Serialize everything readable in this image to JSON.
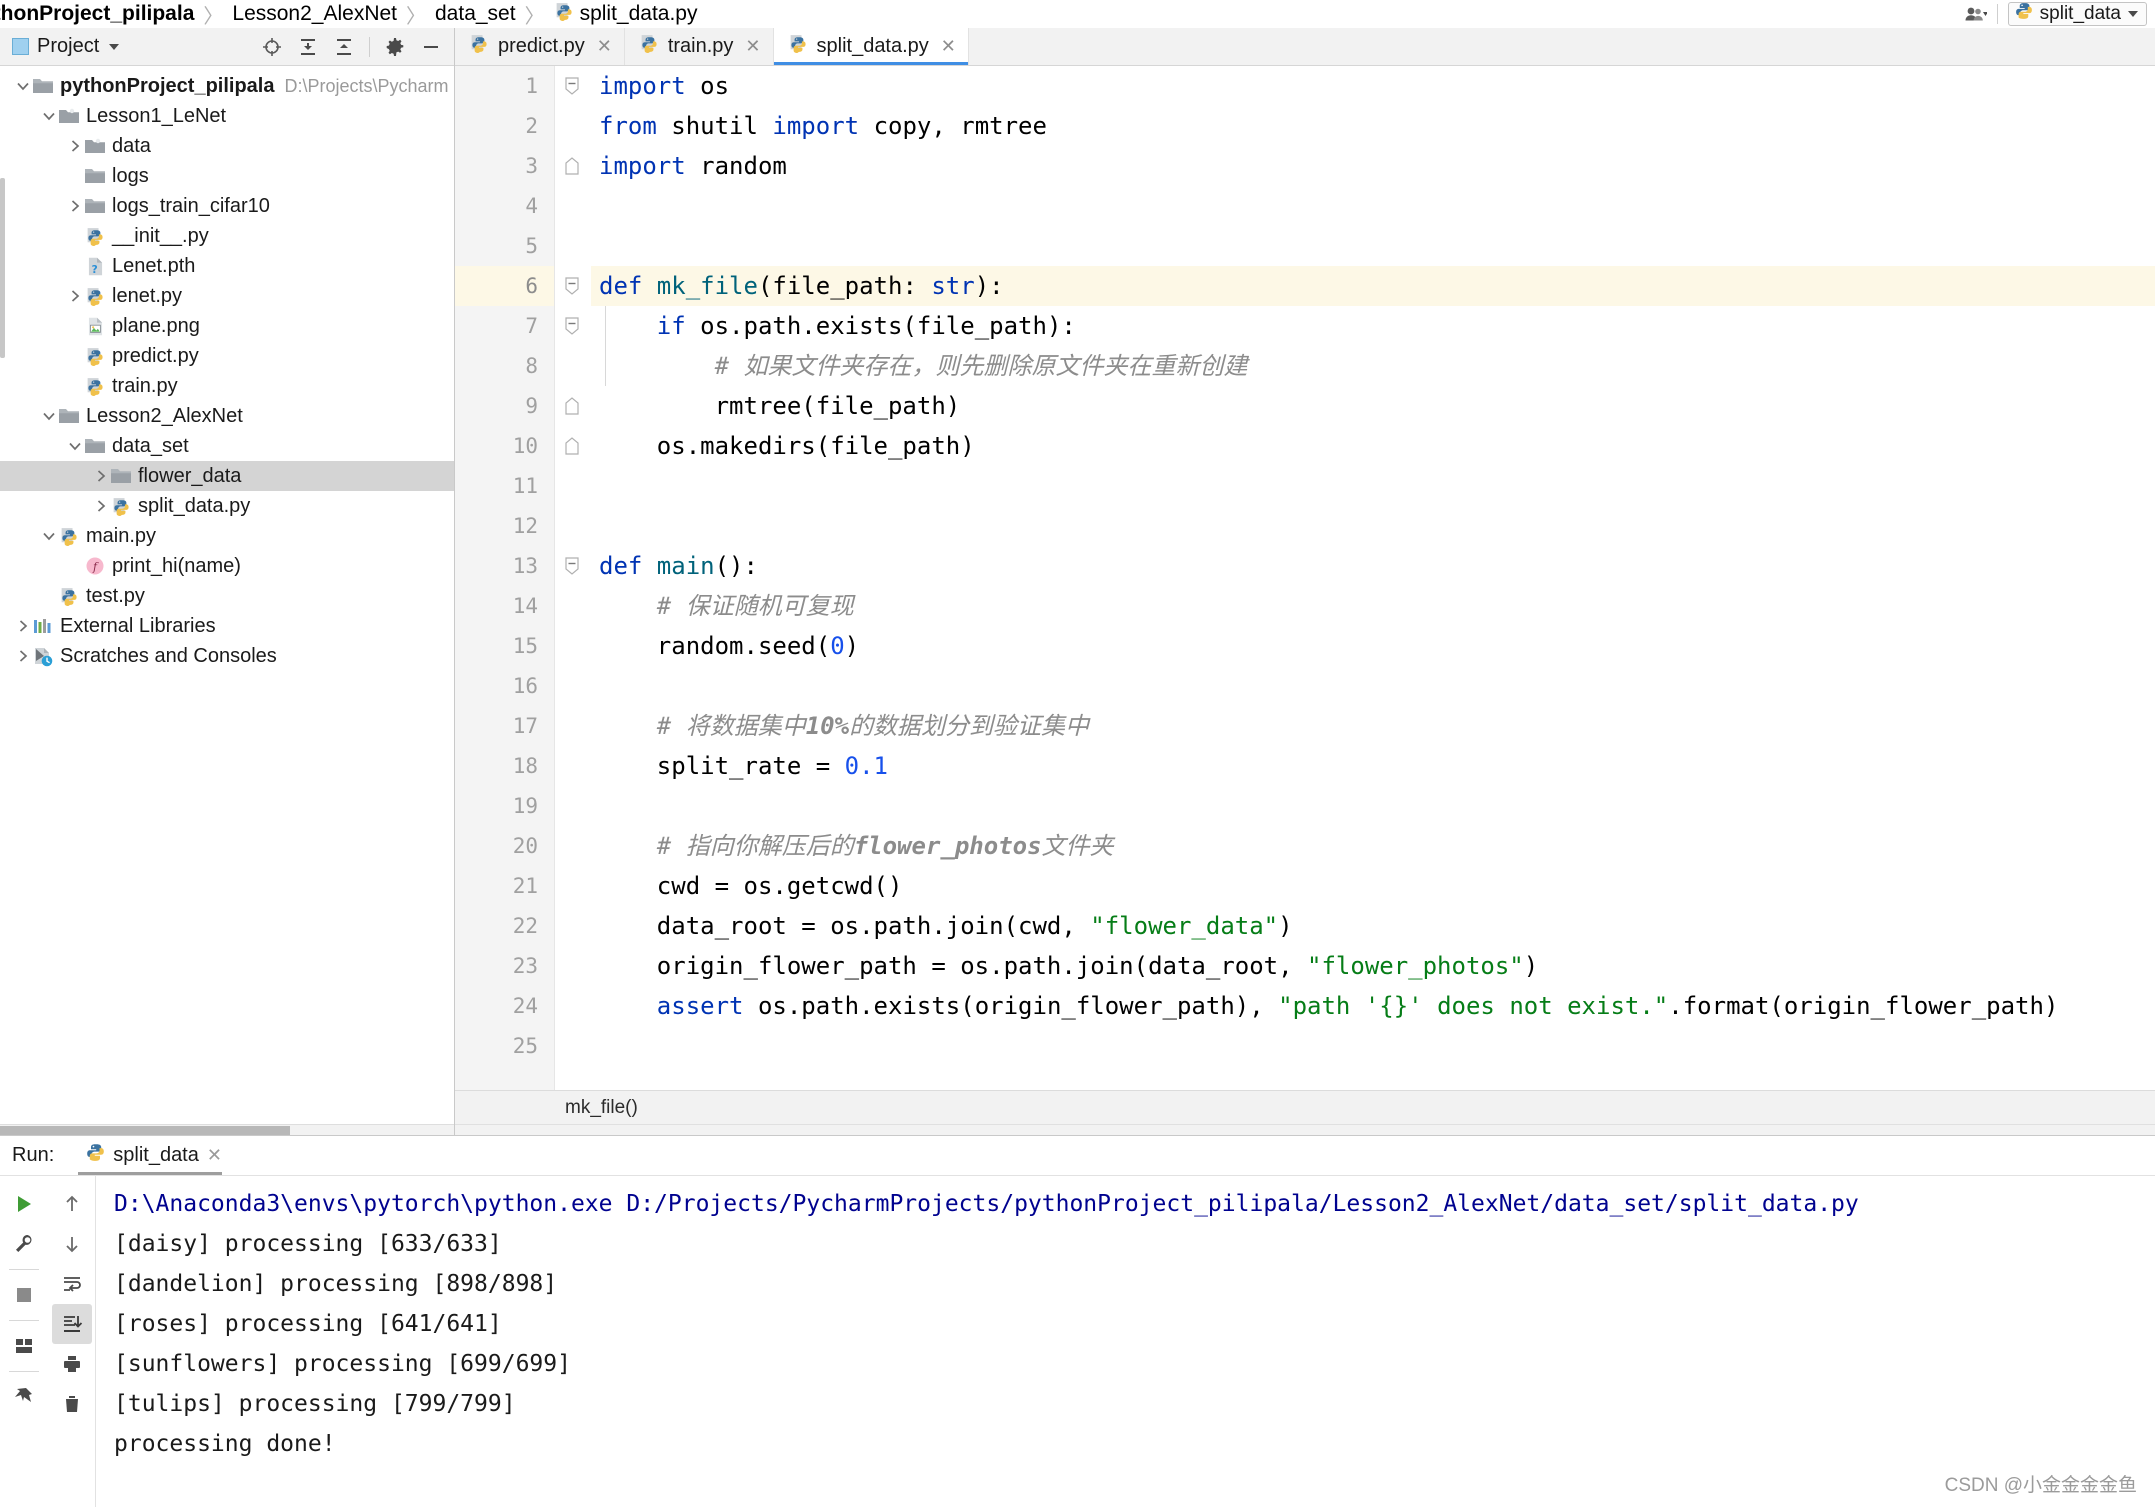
{
  "breadcrumb": {
    "items": [
      "ythonProject_pilipala",
      "Lesson2_AlexNet",
      "data_set",
      "split_data.py"
    ],
    "separator": "〉"
  },
  "titlebar_right": {
    "account_icon": "user-icon",
    "run_config": "split_data"
  },
  "project_panel": {
    "title": "Project",
    "icons": [
      "locate-icon",
      "expand-all-icon",
      "collapse-all-icon",
      "gear-icon",
      "minimize-icon"
    ],
    "tree": [
      {
        "depth": 0,
        "arrow": "down",
        "icon": "folder",
        "label": "pythonProject_pilipala",
        "bold": true,
        "hint": "D:\\Projects\\Pycharm",
        "selected": false
      },
      {
        "depth": 1,
        "arrow": "down",
        "icon": "module",
        "label": "Lesson1_LeNet",
        "bold": false,
        "hint": "",
        "selected": false
      },
      {
        "depth": 2,
        "arrow": "right",
        "icon": "module",
        "label": "data",
        "bold": false,
        "hint": "",
        "selected": false
      },
      {
        "depth": 2,
        "arrow": "none",
        "icon": "folder",
        "label": "logs",
        "bold": false,
        "hint": "",
        "selected": false
      },
      {
        "depth": 2,
        "arrow": "right",
        "icon": "folder",
        "label": "logs_train_cifar10",
        "bold": false,
        "hint": "",
        "selected": false
      },
      {
        "depth": 2,
        "arrow": "none",
        "icon": "python",
        "label": "__init__.py",
        "bold": false,
        "hint": "",
        "selected": false
      },
      {
        "depth": 2,
        "arrow": "none",
        "icon": "unknown",
        "label": "Lenet.pth",
        "bold": false,
        "hint": "",
        "selected": false
      },
      {
        "depth": 2,
        "arrow": "right",
        "icon": "python",
        "label": "lenet.py",
        "bold": false,
        "hint": "",
        "selected": false
      },
      {
        "depth": 2,
        "arrow": "none",
        "icon": "image",
        "label": "plane.png",
        "bold": false,
        "hint": "",
        "selected": false
      },
      {
        "depth": 2,
        "arrow": "none",
        "icon": "python",
        "label": "predict.py",
        "bold": false,
        "hint": "",
        "selected": false
      },
      {
        "depth": 2,
        "arrow": "none",
        "icon": "python",
        "label": "train.py",
        "bold": false,
        "hint": "",
        "selected": false
      },
      {
        "depth": 1,
        "arrow": "down",
        "icon": "folder",
        "label": "Lesson2_AlexNet",
        "bold": false,
        "hint": "",
        "selected": false
      },
      {
        "depth": 2,
        "arrow": "down",
        "icon": "folder",
        "label": "data_set",
        "bold": false,
        "hint": "",
        "selected": false
      },
      {
        "depth": 3,
        "arrow": "right",
        "icon": "folder",
        "label": "flower_data",
        "bold": false,
        "hint": "",
        "selected": true
      },
      {
        "depth": 3,
        "arrow": "right",
        "icon": "python",
        "label": "split_data.py",
        "bold": false,
        "hint": "",
        "selected": false
      },
      {
        "depth": 1,
        "arrow": "down",
        "icon": "python",
        "label": "main.py",
        "bold": false,
        "hint": "",
        "selected": false
      },
      {
        "depth": 2,
        "arrow": "none",
        "icon": "function",
        "label": "print_hi(name)",
        "bold": false,
        "hint": "",
        "selected": false
      },
      {
        "depth": 1,
        "arrow": "none",
        "icon": "python",
        "label": "test.py",
        "bold": false,
        "hint": "",
        "selected": false
      },
      {
        "depth": 0,
        "arrow": "right",
        "icon": "libs",
        "label": "External Libraries",
        "bold": false,
        "hint": "",
        "selected": false
      },
      {
        "depth": 0,
        "arrow": "right",
        "icon": "scratch",
        "label": "Scratches and Consoles",
        "bold": false,
        "hint": "",
        "selected": false
      }
    ]
  },
  "editor": {
    "tabs": [
      {
        "label": "predict.py",
        "icon": "python",
        "active": false,
        "closable": true
      },
      {
        "label": "train.py",
        "icon": "python",
        "active": false,
        "closable": true
      },
      {
        "label": "split_data.py",
        "icon": "python",
        "active": true,
        "closable": true
      }
    ],
    "current_line": 6,
    "status_breadcrumb": "mk_file()",
    "line_numbers": [
      1,
      2,
      3,
      4,
      5,
      6,
      7,
      8,
      9,
      10,
      11,
      12,
      13,
      14,
      15,
      16,
      17,
      18,
      19,
      20,
      21,
      22,
      23,
      24,
      25
    ],
    "code": [
      {
        "n": 1,
        "tokens": [
          {
            "t": "import ",
            "c": "kw"
          },
          {
            "t": "os",
            "c": "pred"
          }
        ]
      },
      {
        "n": 2,
        "tokens": [
          {
            "t": "from ",
            "c": "kw"
          },
          {
            "t": "shutil ",
            "c": "pred"
          },
          {
            "t": "import ",
            "c": "kw"
          },
          {
            "t": "copy, rmtree",
            "c": "pred"
          }
        ]
      },
      {
        "n": 3,
        "tokens": [
          {
            "t": "import ",
            "c": "kw"
          },
          {
            "t": "random",
            "c": "pred"
          }
        ]
      },
      {
        "n": 4,
        "tokens": []
      },
      {
        "n": 5,
        "tokens": []
      },
      {
        "n": 6,
        "tokens": [
          {
            "t": "def ",
            "c": "kw"
          },
          {
            "t": "mk_file",
            "c": "fn"
          },
          {
            "t": "(file_path: ",
            "c": "pred"
          },
          {
            "t": "str",
            "c": "kw"
          },
          {
            "t": "):",
            "c": "pred"
          }
        ]
      },
      {
        "n": 7,
        "tokens": [
          {
            "t": "    ",
            "c": "pred"
          },
          {
            "t": "if ",
            "c": "kw"
          },
          {
            "t": "os.path.exists(file_path):",
            "c": "pred"
          }
        ]
      },
      {
        "n": 8,
        "tokens": [
          {
            "t": "        ",
            "c": "pred"
          },
          {
            "t": "# ",
            "c": "cmt"
          },
          {
            "t": "如果文件夹存在，则先删除原文件夹在重新创建",
            "c": "cmt"
          }
        ]
      },
      {
        "n": 9,
        "tokens": [
          {
            "t": "        rmtree(file_path)",
            "c": "pred"
          }
        ]
      },
      {
        "n": 10,
        "tokens": [
          {
            "t": "    os.makedirs(file_path)",
            "c": "pred"
          }
        ]
      },
      {
        "n": 11,
        "tokens": []
      },
      {
        "n": 12,
        "tokens": []
      },
      {
        "n": 13,
        "tokens": [
          {
            "t": "def ",
            "c": "kw"
          },
          {
            "t": "main",
            "c": "fn"
          },
          {
            "t": "():",
            "c": "pred"
          }
        ]
      },
      {
        "n": 14,
        "tokens": [
          {
            "t": "    ",
            "c": "pred"
          },
          {
            "t": "# ",
            "c": "cmt"
          },
          {
            "t": "保证随机可复现",
            "c": "cmt"
          }
        ]
      },
      {
        "n": 15,
        "tokens": [
          {
            "t": "    random.seed(",
            "c": "pred"
          },
          {
            "t": "0",
            "c": "num"
          },
          {
            "t": ")",
            "c": "pred"
          }
        ]
      },
      {
        "n": 16,
        "tokens": []
      },
      {
        "n": 17,
        "tokens": [
          {
            "t": "    ",
            "c": "pred"
          },
          {
            "t": "# ",
            "c": "cmt"
          },
          {
            "t": "将数据集中",
            "c": "cmt"
          },
          {
            "t": "10%",
            "c": "cmtb"
          },
          {
            "t": "的数据划分到验证集中",
            "c": "cmt"
          }
        ]
      },
      {
        "n": 18,
        "tokens": [
          {
            "t": "    split_rate = ",
            "c": "pred"
          },
          {
            "t": "0.1",
            "c": "num"
          }
        ]
      },
      {
        "n": 19,
        "tokens": []
      },
      {
        "n": 20,
        "tokens": [
          {
            "t": "    ",
            "c": "pred"
          },
          {
            "t": "# ",
            "c": "cmt"
          },
          {
            "t": "指向你解压后的",
            "c": "cmt"
          },
          {
            "t": "flower_photos",
            "c": "cmtb"
          },
          {
            "t": "文件夹",
            "c": "cmt"
          }
        ]
      },
      {
        "n": 21,
        "tokens": [
          {
            "t": "    cwd = os.getcwd()",
            "c": "pred"
          }
        ]
      },
      {
        "n": 22,
        "tokens": [
          {
            "t": "    data_root = os.path.join(cwd, ",
            "c": "pred"
          },
          {
            "t": "\"flower_data\"",
            "c": "str"
          },
          {
            "t": ")",
            "c": "pred"
          }
        ]
      },
      {
        "n": 23,
        "tokens": [
          {
            "t": "    origin_flower_path = os.path.join(data_root, ",
            "c": "pred"
          },
          {
            "t": "\"flower_photos\"",
            "c": "str"
          },
          {
            "t": ")",
            "c": "pred"
          }
        ]
      },
      {
        "n": 24,
        "tokens": [
          {
            "t": "    ",
            "c": "pred"
          },
          {
            "t": "assert ",
            "c": "kw"
          },
          {
            "t": "os.path.exists(origin_flower_path), ",
            "c": "pred"
          },
          {
            "t": "\"path '{}' does not exist.\"",
            "c": "str"
          },
          {
            "t": ".format(origin_flower_path)",
            "c": "pred"
          }
        ]
      },
      {
        "n": 25,
        "tokens": []
      }
    ],
    "folds": [
      {
        "line": 1,
        "type": "minus"
      },
      {
        "line": 3,
        "type": "end"
      },
      {
        "line": 6,
        "type": "minus"
      },
      {
        "line": 7,
        "type": "minus"
      },
      {
        "line": 9,
        "type": "end"
      },
      {
        "line": 10,
        "type": "end"
      },
      {
        "line": 13,
        "type": "minus"
      }
    ]
  },
  "run_panel": {
    "label": "Run:",
    "tab_label": "split_data",
    "left_rail": [
      "run-icon",
      "wrench-icon",
      "stop-icon",
      "layout-icon",
      "pin-icon"
    ],
    "mid_rail": [
      "scroll-up-icon",
      "scroll-down-icon",
      "soft-wrap-icon",
      "scroll-to-end-icon",
      "print-icon",
      "trash-icon"
    ],
    "console": [
      {
        "text": "D:\\Anaconda3\\envs\\pytorch\\python.exe D:/Projects/PycharmProjects/pythonProject_pilipala/Lesson2_AlexNet/data_set/split_data.py",
        "kind": "cmd"
      },
      {
        "text": "[daisy] processing [633/633]",
        "kind": "out"
      },
      {
        "text": "[dandelion] processing [898/898]",
        "kind": "out"
      },
      {
        "text": "[roses] processing [641/641]",
        "kind": "out"
      },
      {
        "text": "[sunflowers] processing [699/699]",
        "kind": "out"
      },
      {
        "text": "[tulips] processing [799/799]",
        "kind": "out"
      },
      {
        "text": "processing done!",
        "kind": "out"
      }
    ]
  },
  "watermark": "CSDN @小金金金金鱼",
  "colors": {
    "accent_tab": "#3f8ee4",
    "selection": "#d4d4d4",
    "current_line": "#fdf8e6",
    "keyword": "#0033b3",
    "string": "#067d17",
    "number": "#1750eb",
    "comment": "#8c8c8c",
    "function": "#00627a",
    "console_cmd": "#00028f"
  }
}
